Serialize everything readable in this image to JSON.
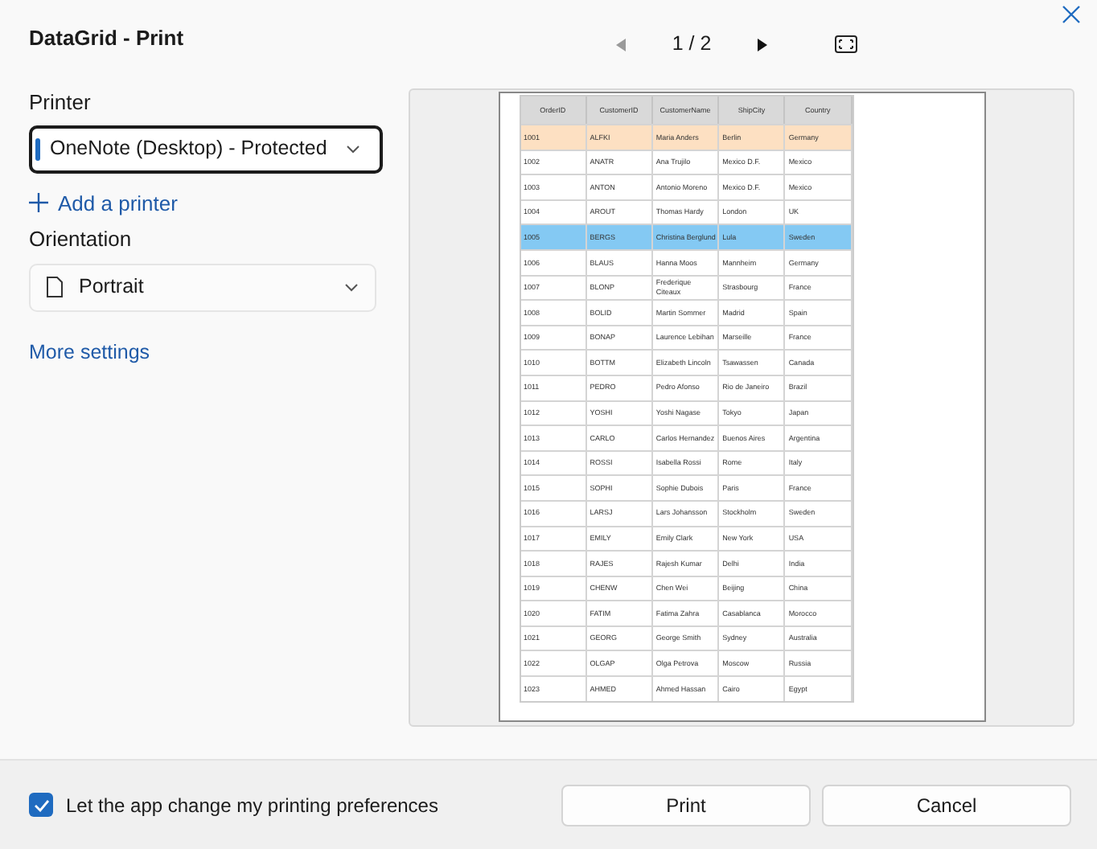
{
  "dialog": {
    "title": "DataGrid - Print"
  },
  "pager": {
    "page": "1 / 2",
    "prev_disabled": true,
    "next_disabled": false
  },
  "printer": {
    "label": "Printer",
    "value": "OneNote (Desktop) - Protected",
    "focused": true
  },
  "add_printer": "Add a printer",
  "orientation": {
    "label": "Orientation",
    "value": "Portrait"
  },
  "more_settings": "More settings",
  "preview": {
    "columns": [
      "OrderID",
      "CustomerID",
      "CustomerName",
      "ShipCity",
      "Country"
    ],
    "rows": [
      {
        "cells": [
          "1001",
          "ALFKI",
          "Maria Anders",
          "Berlin",
          "Germany"
        ],
        "highlighted": true,
        "selected": false
      },
      {
        "cells": [
          "1002",
          "ANATR",
          "Ana Trujilo",
          "Mexico D.F.",
          "Mexico"
        ],
        "highlighted": false,
        "selected": false
      },
      {
        "cells": [
          "1003",
          "ANTON",
          "Antonio Moreno",
          "Mexico D.F.",
          "Mexico"
        ],
        "highlighted": false,
        "selected": false
      },
      {
        "cells": [
          "1004",
          "AROUT",
          "Thomas Hardy",
          "London",
          "UK"
        ],
        "highlighted": false,
        "selected": false
      },
      {
        "cells": [
          "1005",
          "BERGS",
          "Christina Berglund",
          "Lula",
          "Sweden"
        ],
        "highlighted": false,
        "selected": true
      },
      {
        "cells": [
          "1006",
          "BLAUS",
          "Hanna Moos",
          "Mannheim",
          "Germany"
        ],
        "highlighted": false,
        "selected": false
      },
      {
        "cells": [
          "1007",
          "BLONP",
          "Frederique Citeaux",
          "Strasbourg",
          "France"
        ],
        "highlighted": false,
        "selected": false
      },
      {
        "cells": [
          "1008",
          "BOLID",
          "Martin Sommer",
          "Madrid",
          "Spain"
        ],
        "highlighted": false,
        "selected": false
      },
      {
        "cells": [
          "1009",
          "BONAP",
          "Laurence Lebihan",
          "Marseille",
          "France"
        ],
        "highlighted": false,
        "selected": false
      },
      {
        "cells": [
          "1010",
          "BOTTM",
          "Elizabeth Lincoln",
          "Tsawassen",
          "Canada"
        ],
        "highlighted": false,
        "selected": false
      },
      {
        "cells": [
          "1011",
          "PEDRO",
          "Pedro Afonso",
          "Rio de Janeiro",
          "Brazil"
        ],
        "highlighted": false,
        "selected": false
      },
      {
        "cells": [
          "1012",
          "YOSHI",
          "Yoshi Nagase",
          "Tokyo",
          "Japan"
        ],
        "highlighted": false,
        "selected": false
      },
      {
        "cells": [
          "1013",
          "CARLO",
          "Carlos Hernandez",
          "Buenos Aires",
          "Argentina"
        ],
        "highlighted": false,
        "selected": false
      },
      {
        "cells": [
          "1014",
          "ROSSI",
          "Isabella Rossi",
          "Rome",
          "Italy"
        ],
        "highlighted": false,
        "selected": false
      },
      {
        "cells": [
          "1015",
          "SOPHI",
          "Sophie Dubois",
          "Paris",
          "France"
        ],
        "highlighted": false,
        "selected": false
      },
      {
        "cells": [
          "1016",
          "LARSJ",
          "Lars Johansson",
          "Stockholm",
          "Sweden"
        ],
        "highlighted": false,
        "selected": false
      },
      {
        "cells": [
          "1017",
          "EMILY",
          "Emily Clark",
          "New York",
          "USA"
        ],
        "highlighted": false,
        "selected": false
      },
      {
        "cells": [
          "1018",
          "RAJES",
          "Rajesh Kumar",
          "Delhi",
          "India"
        ],
        "highlighted": false,
        "selected": false
      },
      {
        "cells": [
          "1019",
          "CHENW",
          "Chen Wei",
          "Beijing",
          "China"
        ],
        "highlighted": false,
        "selected": false
      },
      {
        "cells": [
          "1020",
          "FATIM",
          "Fatima Zahra",
          "Casablanca",
          "Morocco"
        ],
        "highlighted": false,
        "selected": false
      },
      {
        "cells": [
          "1021",
          "GEORG",
          "George Smith",
          "Sydney",
          "Australia"
        ],
        "highlighted": false,
        "selected": false
      },
      {
        "cells": [
          "1022",
          "OLGAP",
          "Olga Petrova",
          "Moscow",
          "Russia"
        ],
        "highlighted": false,
        "selected": false
      },
      {
        "cells": [
          "1023",
          "AHMED",
          "Ahmed Hassan",
          "Cairo",
          "Egypt"
        ],
        "highlighted": false,
        "selected": false
      }
    ]
  },
  "footer": {
    "checkbox": {
      "label": "Let the app change my printing preferences",
      "checked": true
    },
    "buttons": [
      "Print",
      "Cancel"
    ]
  }
}
